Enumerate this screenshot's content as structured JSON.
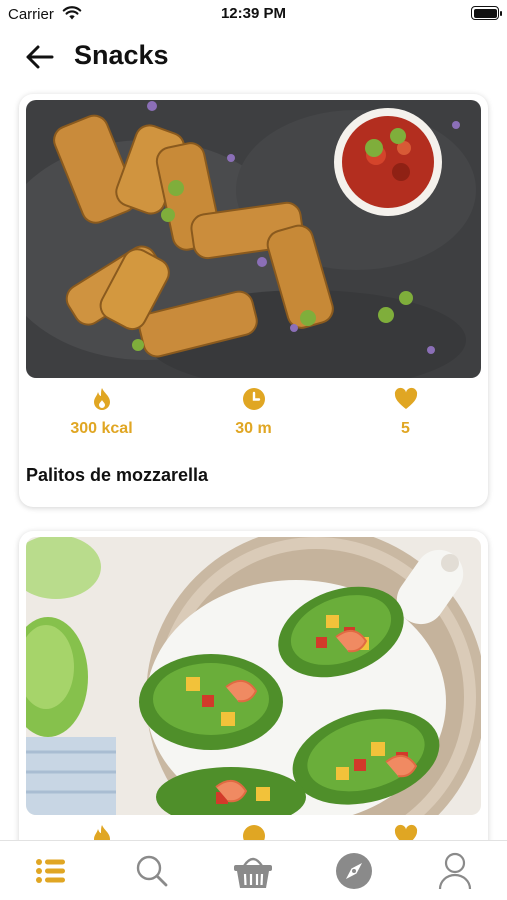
{
  "status_bar": {
    "carrier": "Carrier",
    "time": "12:39 PM"
  },
  "header": {
    "title": "Snacks",
    "back_icon": "arrow-left-icon"
  },
  "recipes": [
    {
      "title": "Palitos de mozzarella",
      "calories": "300 kcal",
      "time": "30 m",
      "likes": "5"
    },
    {
      "title": "",
      "calories": "",
      "time": "",
      "likes": ""
    }
  ],
  "stat_icons": {
    "calories": "flame-icon",
    "time": "clock-icon",
    "likes": "heart-icon"
  },
  "tab_bar": {
    "tabs": [
      {
        "name": "list",
        "icon": "list-icon",
        "active": true
      },
      {
        "name": "search",
        "icon": "search-icon",
        "active": false
      },
      {
        "name": "basket",
        "icon": "basket-icon",
        "active": false
      },
      {
        "name": "explore",
        "icon": "compass-icon",
        "active": false
      },
      {
        "name": "profile",
        "icon": "user-icon",
        "active": false
      }
    ]
  },
  "colors": {
    "accent": "#e0a623",
    "tab_inactive": "#8a8a8a",
    "text": "#111111"
  }
}
